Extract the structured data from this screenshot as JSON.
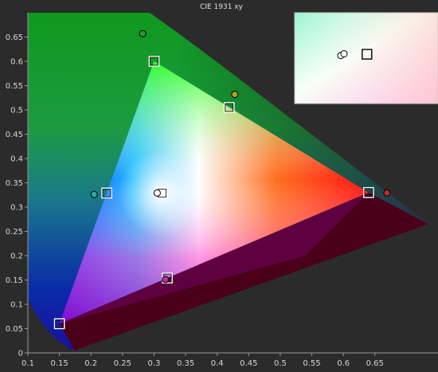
{
  "chart_data": {
    "type": "scatter",
    "title": "CIE 1931 xy",
    "xlim": [
      0.1,
      0.75
    ],
    "ylim": [
      0,
      0.7
    ],
    "x_ticks": [
      0.1,
      0.15,
      0.2,
      0.25,
      0.3,
      0.35,
      0.4,
      0.45,
      0.5,
      0.55,
      0.6,
      0.65
    ],
    "x_tick_labels": [
      "0.1",
      "0.15",
      "0.2",
      "0.25",
      "0.3",
      "0.35",
      "0.4",
      "0.45",
      "0.5",
      "0.55",
      "0.6",
      "0.65"
    ],
    "y_ticks": [
      0,
      0.05,
      0.1,
      0.15,
      0.2,
      0.25,
      0.3,
      0.35,
      0.4,
      0.45,
      0.5,
      0.55,
      0.6,
      0.65
    ],
    "y_tick_labels": [
      "0",
      "0.05",
      "0.1",
      "0.15",
      "0.2",
      "0.25",
      "0.3",
      "0.35",
      "0.4",
      "0.45",
      "0.5",
      "0.55",
      "0.6",
      "0.65"
    ],
    "grid": false,
    "series": [
      {
        "marker": "square",
        "points": [
          {
            "x": 0.64,
            "y": 0.33
          },
          {
            "x": 0.3,
            "y": 0.6
          },
          {
            "x": 0.15,
            "y": 0.06
          },
          {
            "x": 0.225,
            "y": 0.329
          },
          {
            "x": 0.419,
            "y": 0.505
          },
          {
            "x": 0.321,
            "y": 0.154
          },
          {
            "x": 0.3127,
            "y": 0.329
          }
        ]
      },
      {
        "marker": "circle",
        "points": [
          {
            "x": 0.669,
            "y": 0.329,
            "color": "#c0262d"
          },
          {
            "x": 0.282,
            "y": 0.657,
            "color": "#2e9a3a"
          },
          {
            "x": 0.205,
            "y": 0.326,
            "color": "#2fa8a0"
          },
          {
            "x": 0.428,
            "y": 0.532,
            "color": "#a9a51e"
          },
          {
            "x": 0.318,
            "y": 0.151,
            "color": "#b4329a"
          },
          {
            "x": 0.305,
            "y": 0.329,
            "color": "#ffffff"
          }
        ]
      }
    ],
    "inset": {
      "xlim": [
        0.29,
        0.335
      ],
      "ylim": [
        0.31,
        0.345
      ],
      "square": {
        "x": 0.3127,
        "y": 0.329
      },
      "circles": [
        {
          "x": 0.3045,
          "y": 0.3285
        },
        {
          "x": 0.3055,
          "y": 0.3292
        }
      ]
    },
    "colors": {
      "background": "#2b2b2b",
      "axis": "#9a9a9a",
      "tick_label": "#d6d6d6",
      "marker_edge": "#000000",
      "inset_border": "#c8c8c8"
    }
  }
}
